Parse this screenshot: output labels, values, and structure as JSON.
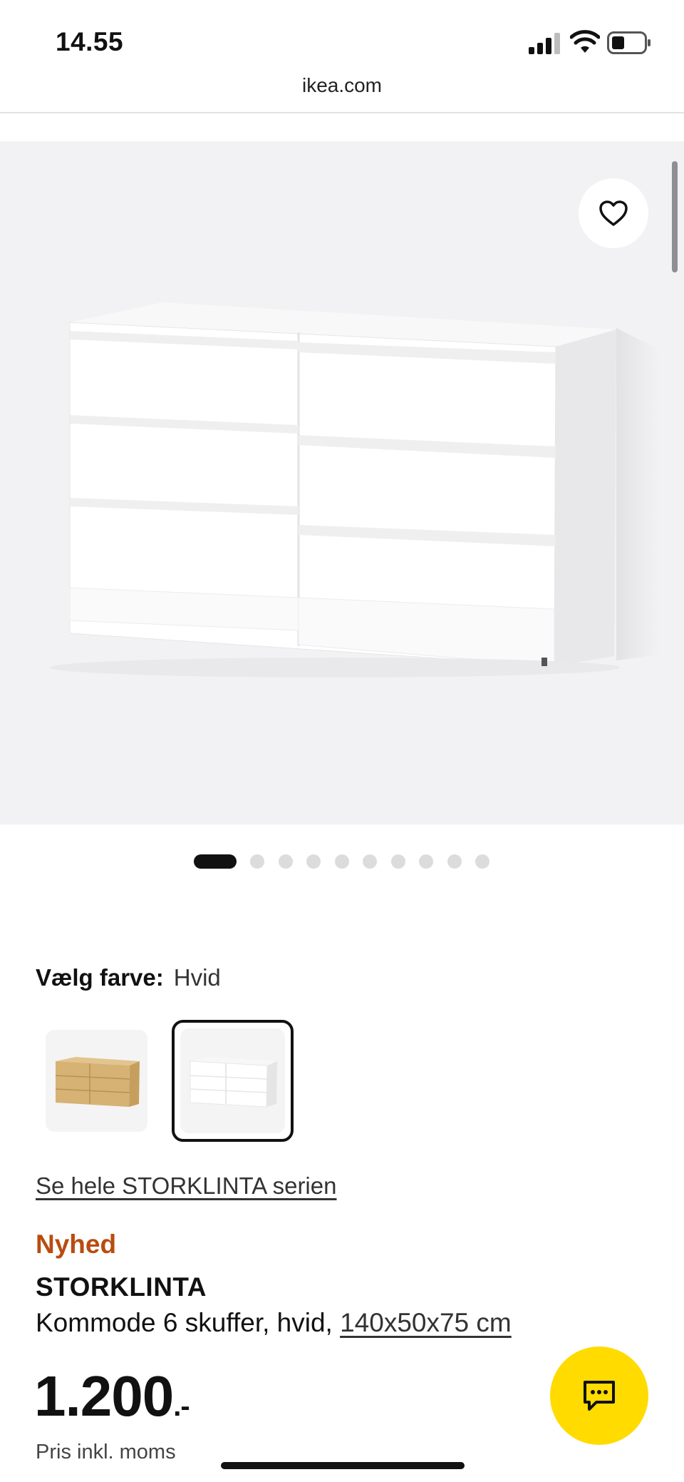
{
  "status_bar": {
    "time": "14.55",
    "icons": [
      "cellular-signal-icon",
      "wifi-icon",
      "battery-icon"
    ]
  },
  "browser": {
    "url": "ikea.com"
  },
  "gallery": {
    "image": "white six-drawer chest of drawers",
    "favorite_icon": "heart-icon",
    "image_count": 11,
    "active_index": 0
  },
  "color_picker": {
    "label": "Vælg farve:",
    "selected_value": "Hvid",
    "options": [
      {
        "name": "oak-effect",
        "color": "#d6b274",
        "selected": false
      },
      {
        "name": "white",
        "color": "#ffffff",
        "selected": true
      }
    ]
  },
  "series_link": "Se hele STORKLINTA serien",
  "product": {
    "badge": "Nyhed",
    "name": "STORKLINTA",
    "description": "Kommode 6 skuffer, hvid, ",
    "dimensions": "140x50x75 cm"
  },
  "price": {
    "amount": "1.200",
    "suffix": ".-",
    "note": "Pris inkl. moms"
  },
  "chat": {
    "icon": "chat-bubble-icon",
    "color": "#ffdb00"
  },
  "colors": {
    "badge_new": "#b94c10",
    "ikea_yellow": "#ffdb00"
  }
}
